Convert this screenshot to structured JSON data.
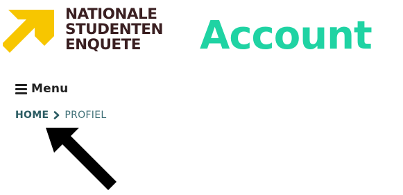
{
  "brand": {
    "name_lines": [
      "NATIONALE",
      "STUDENTEN",
      "ENQUETE"
    ],
    "logo_icon": "yellow-arrow-logo",
    "colors": {
      "yellow": "#f7c600",
      "dark": "#3a1f21"
    }
  },
  "page_title": "Account",
  "menu": {
    "label": "Menu",
    "icon": "hamburger-icon"
  },
  "breadcrumb": {
    "items": [
      "HOME",
      "PROFIEL"
    ],
    "separator_icon": "chevron-right-icon"
  },
  "overlay": {
    "icon": "pointer-arrow-icon"
  },
  "colors": {
    "accent": "#1fd3a3",
    "text_dark": "#222222",
    "crumb": "#2a5b62",
    "crumb_current": "#3d6e75",
    "pointer": "#000000"
  }
}
